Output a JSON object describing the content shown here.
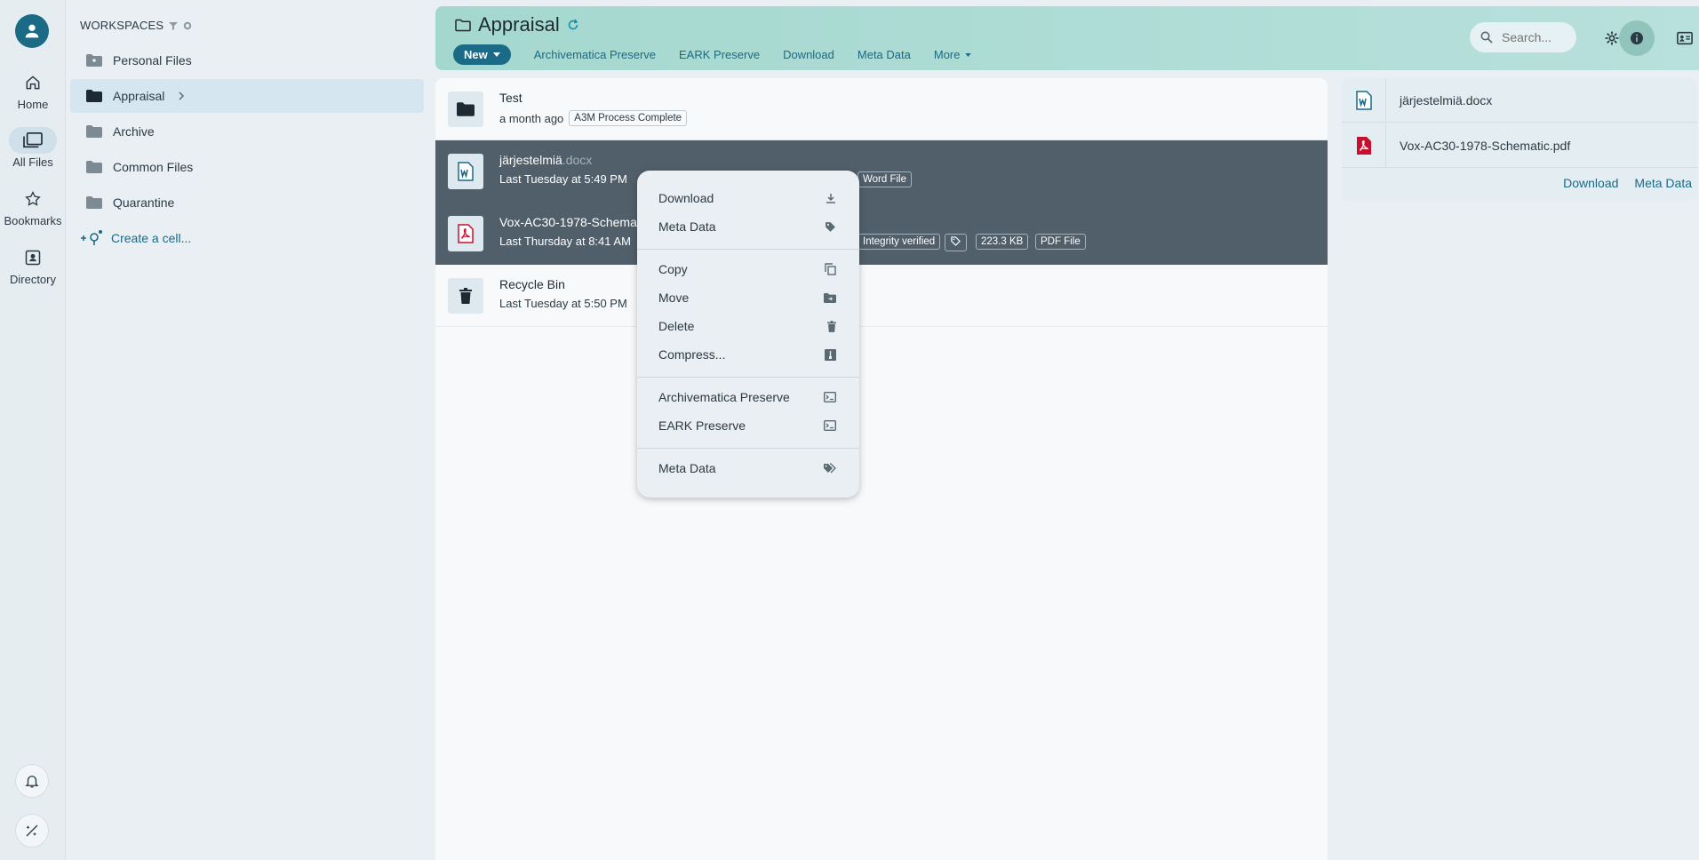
{
  "rail": {
    "items": [
      {
        "label": "Home",
        "icon": "home-icon"
      },
      {
        "label": "All Files",
        "icon": "files-icon"
      },
      {
        "label": "Bookmarks",
        "icon": "star-icon"
      },
      {
        "label": "Directory",
        "icon": "directory-icon"
      }
    ]
  },
  "workspaces": {
    "heading": "WORKSPACES",
    "items": [
      {
        "label": "Personal Files"
      },
      {
        "label": "Appraisal"
      },
      {
        "label": "Archive"
      },
      {
        "label": "Common Files"
      },
      {
        "label": "Quarantine"
      }
    ],
    "create_label": "Create a cell..."
  },
  "header": {
    "title": "Appraisal",
    "new_label": "New",
    "toolbar": [
      "Archivematica Preserve",
      "EARK Preserve",
      "Download",
      "Meta Data",
      "More"
    ],
    "search_placeholder": "Search..."
  },
  "files": [
    {
      "name": "Test",
      "ext": "",
      "date": "a month ago",
      "tags": [
        "A3M Process Complete"
      ]
    },
    {
      "name": "järjestelmiä",
      "ext": ".docx",
      "date": "Last Tuesday at 5:49 PM",
      "tags": [
        "Word File"
      ]
    },
    {
      "name": "Vox-AC30-1978-Schema",
      "ext": "",
      "date": "Last Thursday at 8:41 AM",
      "tags": [
        "Integrity verified",
        "223.3 KB",
        "PDF File"
      ]
    },
    {
      "name": "Recycle Bin",
      "ext": "",
      "date": "Last Tuesday at 5:50 PM",
      "tags": []
    }
  ],
  "context_menu": {
    "group1": [
      "Download",
      "Meta Data"
    ],
    "group2": [
      "Copy",
      "Move",
      "Delete",
      "Compress..."
    ],
    "group3": [
      "Archivematica Preserve",
      "EARK Preserve"
    ],
    "group4": [
      "Meta Data"
    ]
  },
  "info_panel": {
    "files": [
      "järjestelmiä.docx",
      "Vox-AC30-1978-Schematic.pdf"
    ],
    "actions": [
      "Download",
      "Meta Data"
    ]
  },
  "colors": {
    "accent": "#1b6a86",
    "selected_row": "#515f6b",
    "header_bg": "#a4d8cf",
    "pdf_red": "#c8102e",
    "word_blue": "#1b6a86"
  }
}
